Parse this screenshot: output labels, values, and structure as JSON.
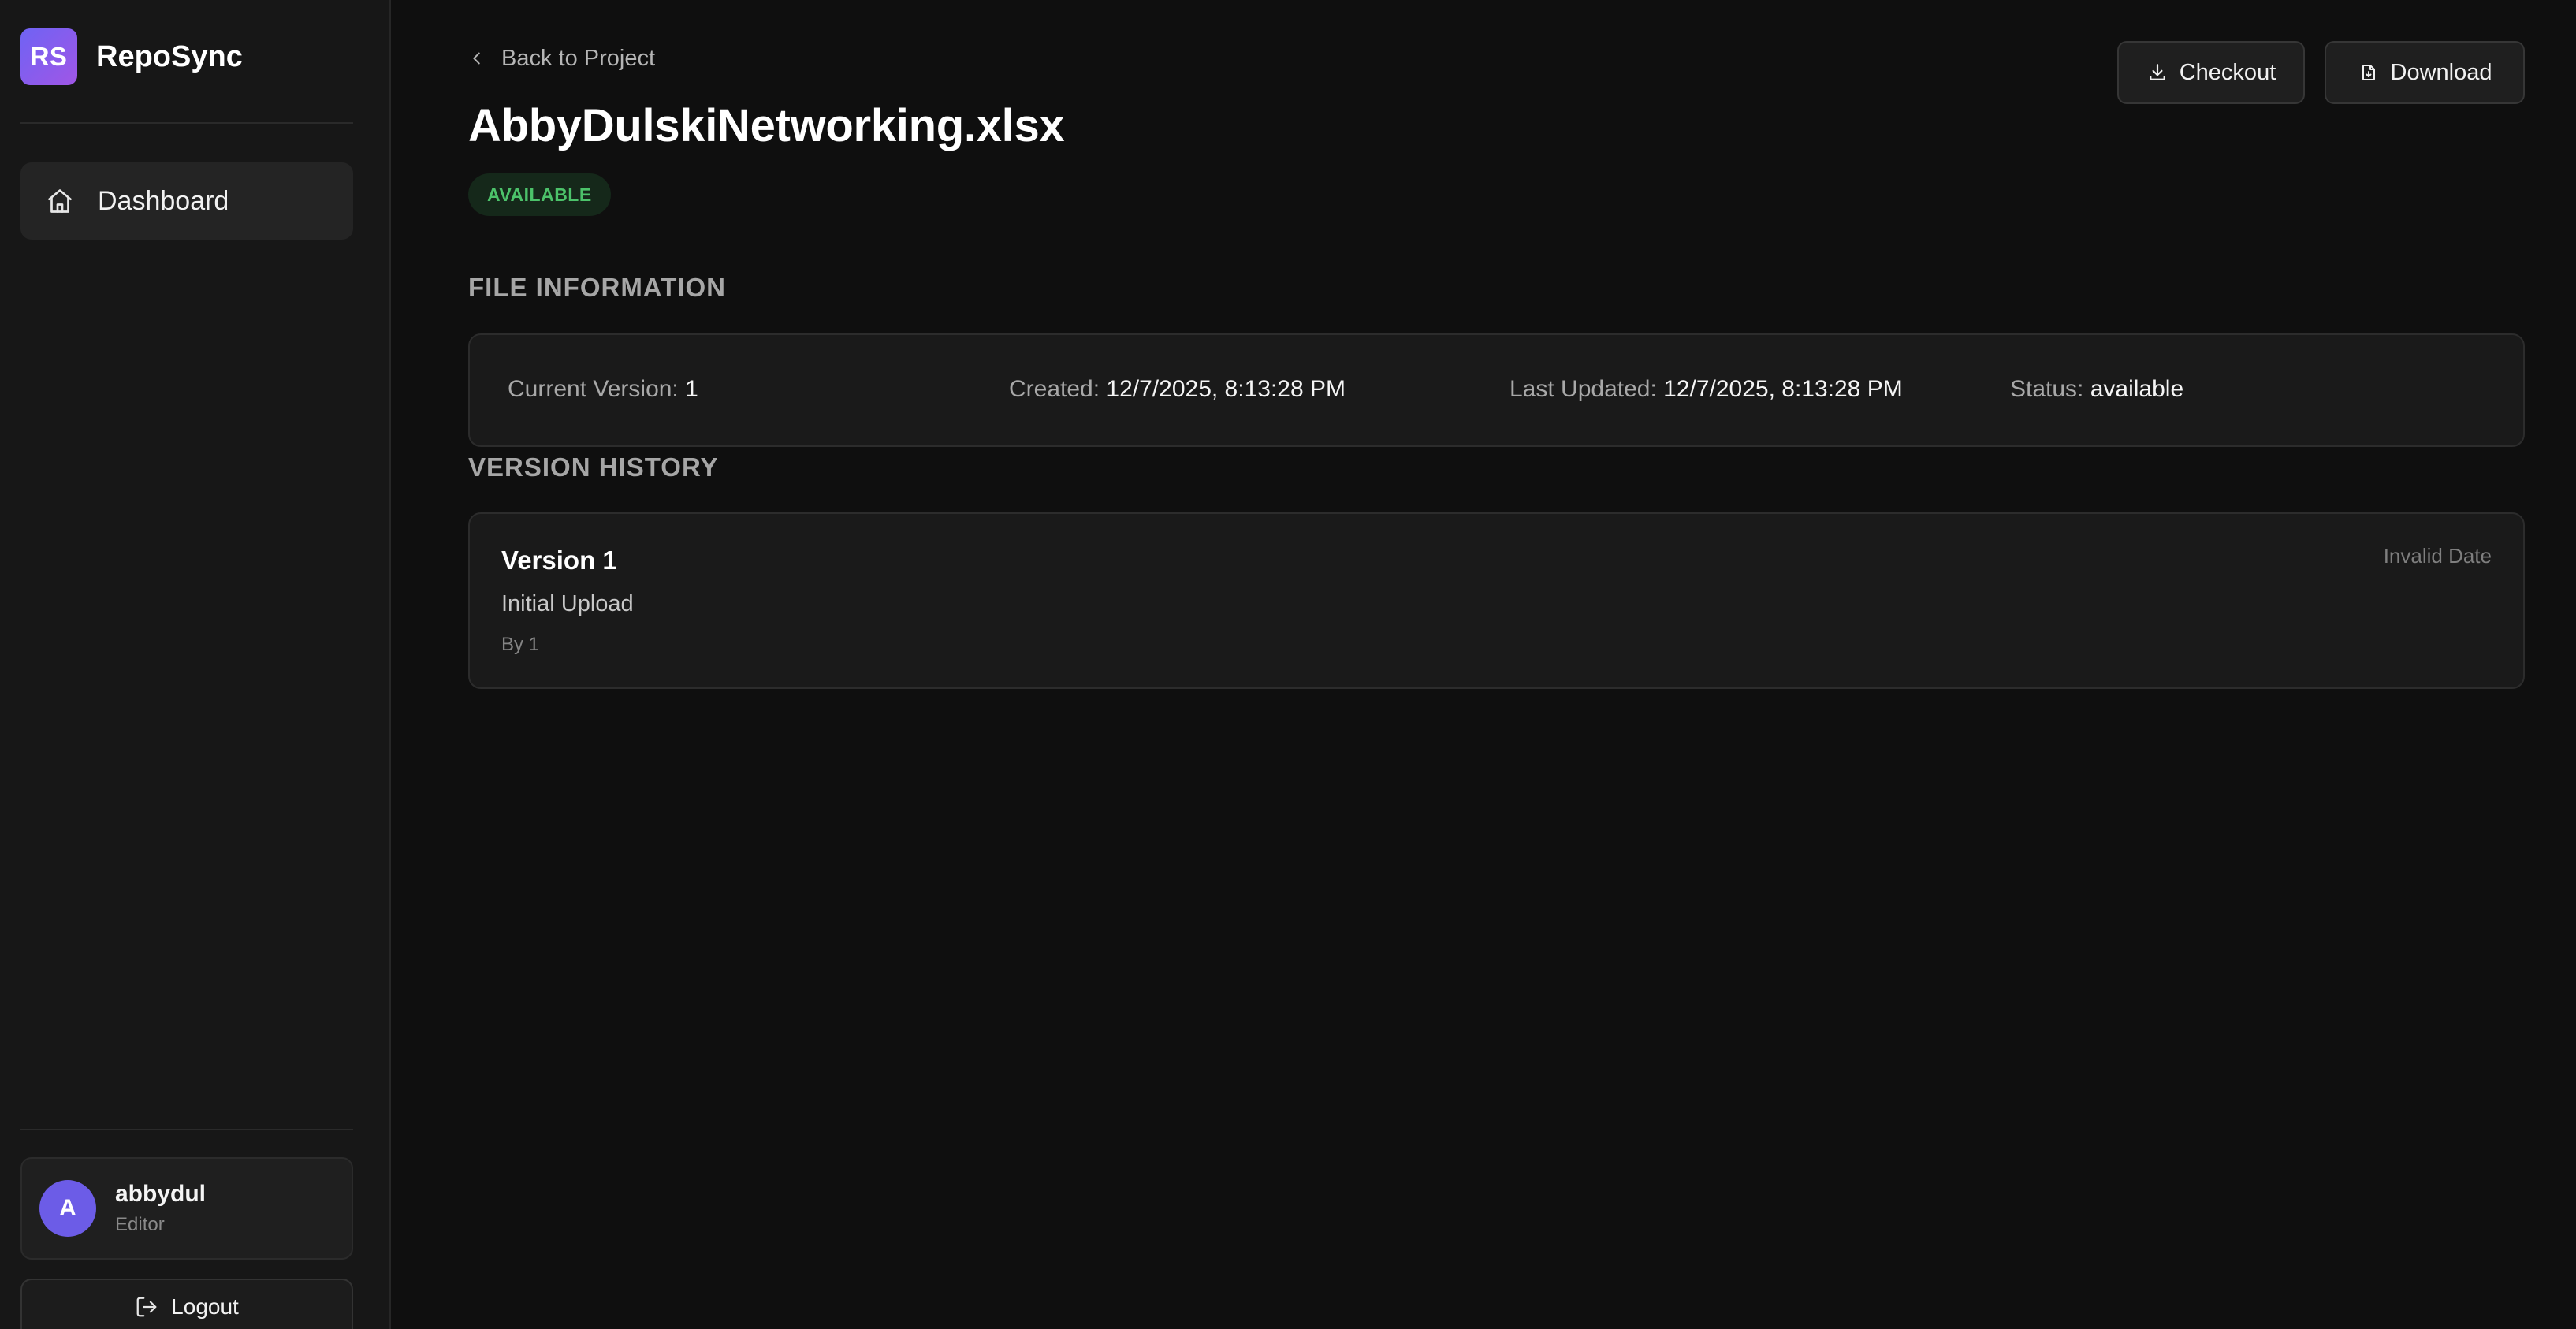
{
  "sidebar": {
    "brand_logo": "RS",
    "brand_name": "RepoSync",
    "nav": [
      {
        "label": "Dashboard",
        "icon": "home-icon",
        "active": true
      }
    ],
    "user": {
      "avatar_letter": "A",
      "name": "abbydul",
      "role": "Editor"
    },
    "logout_label": "Logout"
  },
  "header": {
    "back_label": "Back to Project",
    "file_name": "AbbyDulskiNetworking.xlsx",
    "status_badge": "AVAILABLE",
    "checkout_label": "Checkout",
    "download_label": "Download"
  },
  "file_info": {
    "section_title": "FILE INFORMATION",
    "fields": [
      {
        "label": "Current Version:",
        "value": "1"
      },
      {
        "label": "Created:",
        "value": "12/7/2025, 8:13:28 PM"
      },
      {
        "label": "Last Updated:",
        "value": "12/7/2025, 8:13:28 PM"
      },
      {
        "label": "Status:",
        "value": "available"
      }
    ]
  },
  "version_history": {
    "section_title": "VERSION HISTORY",
    "versions": [
      {
        "title": "Version 1",
        "message": "Initial Upload",
        "author": "By 1",
        "date": "Invalid Date"
      }
    ]
  },
  "colors": {
    "background": "#0f0f0f",
    "sidebar": "#171717",
    "accent": "#6f63f4",
    "status_available": "#4cc26a"
  }
}
